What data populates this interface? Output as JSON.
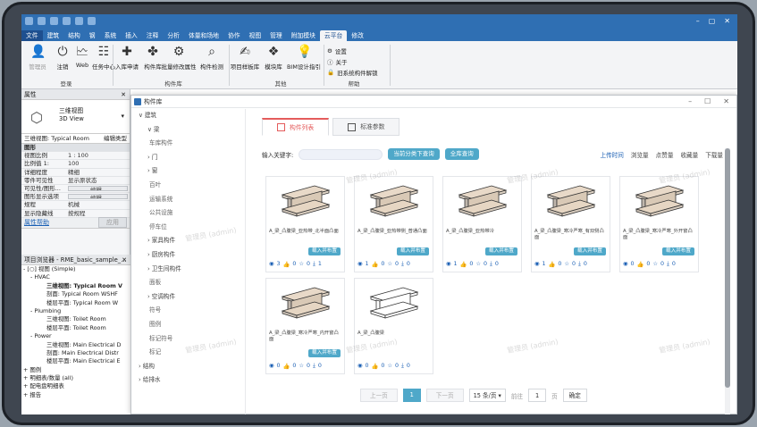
{
  "ribbon_tabs": [
    "文件",
    "建筑",
    "结构",
    "钢",
    "系统",
    "插入",
    "注释",
    "分析",
    "体量和场地",
    "协作",
    "视图",
    "管理",
    "附加模块",
    "云平台",
    "修改"
  ],
  "active_tab": "云平台",
  "ribbon": {
    "login_group": {
      "label": "登录",
      "buttons": [
        "管理员",
        "注销",
        "Web",
        "任务中心"
      ]
    },
    "library_group": {
      "label": "构件库",
      "buttons": [
        "入库申请",
        "构件库",
        "批量修改属性",
        "构件检测"
      ]
    },
    "other_group": {
      "label": "其他",
      "buttons": [
        "项目样板库",
        "模块库",
        "BIM设计指引"
      ]
    },
    "help_group": {
      "label": "帮助",
      "items": [
        "设置",
        "关于",
        "旧系统构件解锁"
      ]
    }
  },
  "properties": {
    "title": "属性",
    "type_name": "三维视图",
    "type_sub": "3D View",
    "selector": "三维视图: Typical Room",
    "edit_type": "编辑类型",
    "rows": [
      {
        "k": "图形",
        "v": "",
        "cat": true
      },
      {
        "k": "视图比例",
        "v": "1 : 100"
      },
      {
        "k": "比例值 1:",
        "v": "100"
      },
      {
        "k": "详细程度",
        "v": "精细"
      },
      {
        "k": "零件可见性",
        "v": "显示原状态"
      },
      {
        "k": "可见性/图形...",
        "v": "编辑...",
        "btn": true
      },
      {
        "k": "图形显示选项",
        "v": "编辑...",
        "btn": true
      },
      {
        "k": "规程",
        "v": "机械"
      },
      {
        "k": "显示隐藏线",
        "v": "按规程"
      }
    ],
    "help_link": "属性帮助",
    "apply": "应用"
  },
  "browser": {
    "title": "项目浏览器 - RME_basic_sample_...",
    "rows": [
      {
        "t": "- [○] 视图 (Simple)",
        "i": 2,
        "b": false
      },
      {
        "t": "- HVAC",
        "i": 10,
        "b": false
      },
      {
        "t": "三维视图: Typical Room V",
        "i": 28,
        "b": true
      },
      {
        "t": "剖面: Typical Room WSHF",
        "i": 28,
        "b": false
      },
      {
        "t": "楼层平面: Typical Room W",
        "i": 28,
        "b": false
      },
      {
        "t": "- Plumbing",
        "i": 10,
        "b": false
      },
      {
        "t": "三维视图: Toilet Room",
        "i": 28,
        "b": false
      },
      {
        "t": "楼层平面: Toilet Room",
        "i": 28,
        "b": false
      },
      {
        "t": "- Power",
        "i": 10,
        "b": false
      },
      {
        "t": "三维视图: Main Electrical D",
        "i": 28,
        "b": false
      },
      {
        "t": "剖面: Main Electrical Distr",
        "i": 28,
        "b": false
      },
      {
        "t": "楼层平面: Main Electrical E",
        "i": 28,
        "b": false
      },
      {
        "t": "+ 图例",
        "i": 2,
        "b": false
      },
      {
        "t": "+ 明细表/数量 (all)",
        "i": 2,
        "b": false
      },
      {
        "t": "+ 配电盘明细表",
        "i": 2,
        "b": false
      },
      {
        "t": "+ 报告",
        "i": 2,
        "b": false
      }
    ]
  },
  "library": {
    "title": "构件库",
    "categories": [
      {
        "t": "∨ 建筑",
        "lv": 0
      },
      {
        "t": "∨ 梁",
        "lv": 1
      },
      {
        "t": "车库构件",
        "lv": 2
      },
      {
        "t": "› 门",
        "lv": 1
      },
      {
        "t": "› 窗",
        "lv": 1
      },
      {
        "t": "百叶",
        "lv": 2
      },
      {
        "t": "运输系统",
        "lv": 2
      },
      {
        "t": "公共设施",
        "lv": 2
      },
      {
        "t": "停车位",
        "lv": 2
      },
      {
        "t": "› 家具构件",
        "lv": 1
      },
      {
        "t": "› 厨房构件",
        "lv": 1
      },
      {
        "t": "› 卫生间构件",
        "lv": 1
      },
      {
        "t": "面板",
        "lv": 2
      },
      {
        "t": "› 空调构件",
        "lv": 1
      },
      {
        "t": "符号",
        "lv": 2
      },
      {
        "t": "图例",
        "lv": 2
      },
      {
        "t": "标记符号",
        "lv": 2
      },
      {
        "t": "标记",
        "lv": 2
      },
      {
        "t": "› 结构",
        "lv": 0
      },
      {
        "t": "› 给排水",
        "lv": 0
      }
    ],
    "tabs": [
      "构件列表",
      "标准参数"
    ],
    "search_label": "输入关键字:",
    "search_placeholder": "",
    "btn_current": "当前分类下查询",
    "btn_all": "全库查询",
    "sorts": [
      "上传时间",
      "浏览量",
      "点赞量",
      "收藏量",
      "下载量"
    ],
    "load_label": "载入并布置",
    "cards": [
      {
        "name": "A_梁_凸腹梁_亚热带_北半面凸面",
        "views": 3,
        "likes": 0,
        "stars": 0,
        "dl": 1
      },
      {
        "name": "A_梁_凸腹梁_亚热带侧_普通凸面",
        "views": 1,
        "likes": 0,
        "stars": 0,
        "dl": 0
      },
      {
        "name": "A_梁_凸腹梁_亚热带冷",
        "views": 1,
        "likes": 0,
        "stars": 0,
        "dl": 0
      },
      {
        "name": "A_梁_凸腹梁_寒冷严寒_有双侧凸面",
        "views": 1,
        "likes": 0,
        "stars": 0,
        "dl": 0
      },
      {
        "name": "A_梁_凸腹梁_寒冷严寒_外开窗凸面",
        "views": 0,
        "likes": 0,
        "stars": 0,
        "dl": 0
      },
      {
        "name": "A_梁_凸腹梁_寒冷严寒_内开窗凸面",
        "views": 0,
        "likes": 0,
        "stars": 0,
        "dl": 0
      },
      {
        "name": "A_梁_凸腹梁",
        "views": 0,
        "likes": 0,
        "stars": 0,
        "dl": 0
      }
    ],
    "pager": {
      "prev": "上一页",
      "page": "1",
      "next": "下一页",
      "size": "15 条/页 ▾",
      "goto": "前往",
      "goto_val": "1",
      "unit": "页",
      "ok": "确定"
    },
    "watermark": "管理员 (admin)"
  },
  "colors": {
    "accent": "#2f6fb3",
    "teal": "#4fa8c9",
    "red": "#e45b5b"
  }
}
